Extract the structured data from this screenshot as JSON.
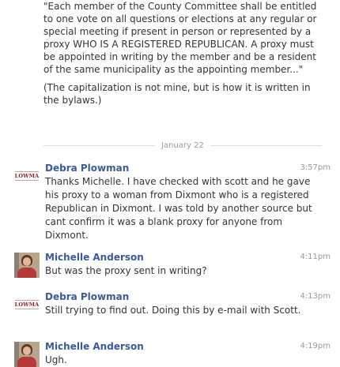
{
  "quote": {
    "paragraph1": "\"Each member of the County Committee shall be entitled to one vote on all questions or elections at any regular or special meeting if present in person or represented by a proxy WHO IS A REGISTERED REPUBLICAN. A proxy must be appointed in writing by the member and be a resident of the same municipality as the appointing member...\"",
    "paragraph2": "(The capitalization is not mine, but is how it is written in the bylaws.)"
  },
  "date_separator": "January 22",
  "messages": [
    {
      "author": "Debra Plowman",
      "time": "3:57pm",
      "text": "Thanks Michelle. I have checked with scott and he gave his proxy to a woman from Dixmont who is a registered Republican in Dixmont. I was told by another source but cant confirm it was a blank proxy for anyone from Dixmont.",
      "avatar": {
        "type": "logo",
        "label": "LOWMA"
      }
    },
    {
      "author": "Michelle Anderson",
      "time": "4:11pm",
      "text": "But was the proxy sent in writing?",
      "avatar": {
        "type": "photo"
      }
    },
    {
      "author": "Debra Plowman",
      "time": "4:13pm",
      "text": "Still trying to find out. Doing this by e-mail with Scott.",
      "avatar": {
        "type": "logo",
        "label": "LOWMA"
      }
    },
    {
      "author": "Michelle Anderson",
      "time": "4:19pm",
      "text": "Ugh.",
      "avatar": {
        "type": "photo"
      }
    }
  ],
  "colors": {
    "author_link": "#3b5998",
    "text": "#333333",
    "timestamp": "#999999"
  }
}
